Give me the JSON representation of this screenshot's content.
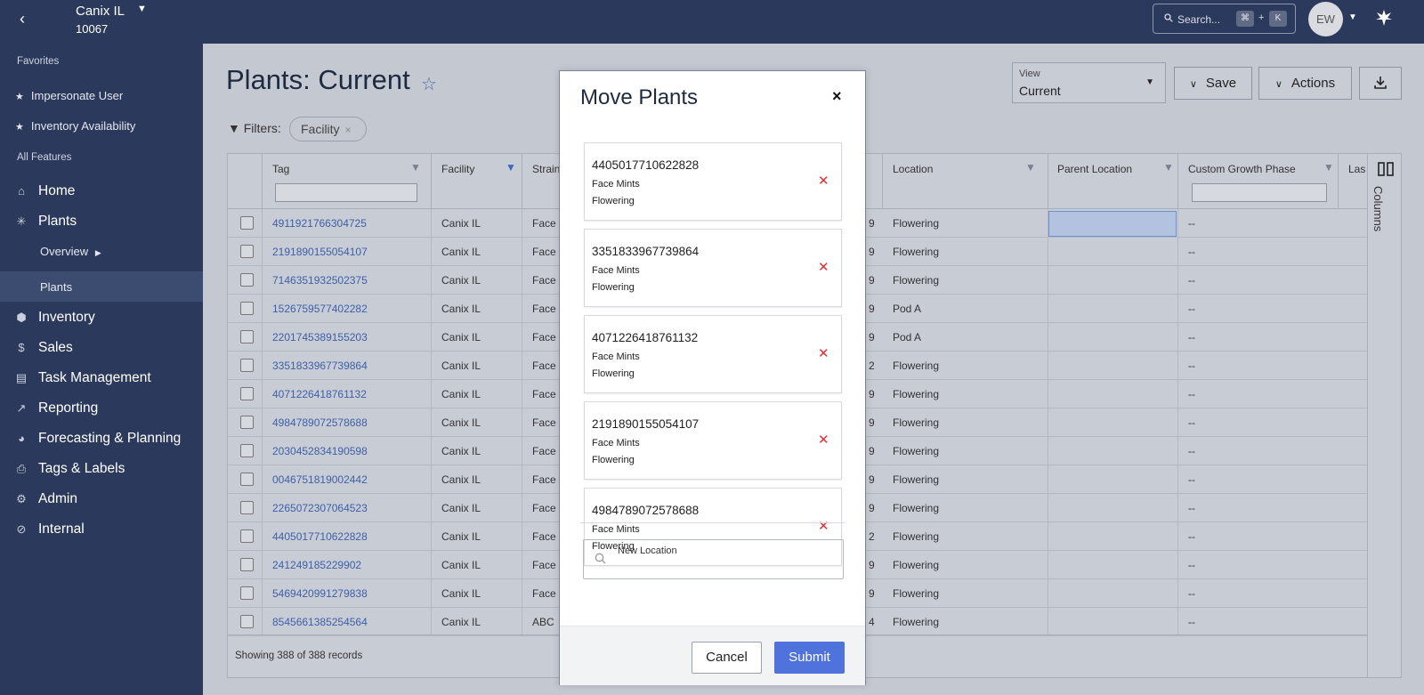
{
  "topbar": {
    "facility_name": "Canix IL",
    "facility_id": "10067",
    "search_placeholder": "Search...",
    "kbd_cmd": "⌘",
    "kbd_plus": "+",
    "kbd_k": "K",
    "avatar_initials": "EW"
  },
  "sidebar": {
    "favorites_heading": "Favorites",
    "favorites": [
      {
        "label": "Impersonate User"
      },
      {
        "label": "Inventory Availability"
      }
    ],
    "all_features_heading": "All Features",
    "items": [
      {
        "label": "Home",
        "icon": "home-icon"
      },
      {
        "label": "Plants",
        "icon": "cannabis-leaf-icon"
      },
      {
        "label": "Inventory",
        "icon": "cube-icon"
      },
      {
        "label": "Sales",
        "icon": "dollar-icon"
      },
      {
        "label": "Task Management",
        "icon": "clipboard-icon"
      },
      {
        "label": "Reporting",
        "icon": "trend-up-icon"
      },
      {
        "label": "Forecasting & Planning",
        "icon": "pie-chart-icon"
      },
      {
        "label": "Tags & Labels",
        "icon": "printer-icon"
      },
      {
        "label": "Admin",
        "icon": "gear-icon"
      },
      {
        "label": "Internal",
        "icon": "eye-slash-icon"
      }
    ],
    "plants_sub": [
      {
        "label": "Overview"
      },
      {
        "label": "Plants"
      }
    ]
  },
  "main": {
    "title": "Plants: Current",
    "filters_label": "Filters:",
    "filter_chip": "Facility",
    "view_label": "View",
    "view_value": "Current",
    "save_label": "Save",
    "actions_label": "Actions"
  },
  "table": {
    "headers": {
      "tag": "Tag",
      "facility": "Facility",
      "strain": "Strain",
      "location": "Location",
      "parent_location": "Parent Location",
      "custom_growth_phase": "Custom Growth Phase",
      "last": "Las"
    },
    "rows": [
      {
        "tag": "4911921766304725",
        "facility": "Canix IL",
        "strain": "Face M",
        "n": "9",
        "location": "Flowering",
        "cgp": "--"
      },
      {
        "tag": "2191890155054107",
        "facility": "Canix IL",
        "strain": "Face M",
        "n": "9",
        "location": "Flowering",
        "cgp": "--"
      },
      {
        "tag": "7146351932502375",
        "facility": "Canix IL",
        "strain": "Face M",
        "n": "9",
        "location": "Flowering",
        "cgp": "--"
      },
      {
        "tag": "1526759577402282",
        "facility": "Canix IL",
        "strain": "Face M",
        "n": "9",
        "location": "Pod A",
        "cgp": "--"
      },
      {
        "tag": "2201745389155203",
        "facility": "Canix IL",
        "strain": "Face M",
        "n": "9",
        "location": "Pod A",
        "cgp": "--"
      },
      {
        "tag": "3351833967739864",
        "facility": "Canix IL",
        "strain": "Face M",
        "n": "2",
        "location": "Flowering",
        "cgp": "--"
      },
      {
        "tag": "4071226418761132",
        "facility": "Canix IL",
        "strain": "Face M",
        "n": "9",
        "location": "Flowering",
        "cgp": "--"
      },
      {
        "tag": "4984789072578688",
        "facility": "Canix IL",
        "strain": "Face M",
        "n": "9",
        "location": "Flowering",
        "cgp": "--"
      },
      {
        "tag": "2030452834190598",
        "facility": "Canix IL",
        "strain": "Face M",
        "n": "9",
        "location": "Flowering",
        "cgp": "--"
      },
      {
        "tag": "0046751819002442",
        "facility": "Canix IL",
        "strain": "Face M",
        "n": "9",
        "location": "Flowering",
        "cgp": "--"
      },
      {
        "tag": "2265072307064523",
        "facility": "Canix IL",
        "strain": "Face M",
        "n": "9",
        "location": "Flowering",
        "cgp": "--"
      },
      {
        "tag": "4405017710622828",
        "facility": "Canix IL",
        "strain": "Face M",
        "n": "2",
        "location": "Flowering",
        "cgp": "--"
      },
      {
        "tag": "241249185229902",
        "facility": "Canix IL",
        "strain": "Face M",
        "n": "9",
        "location": "Flowering",
        "cgp": "--"
      },
      {
        "tag": "5469420991279838",
        "facility": "Canix IL",
        "strain": "Face M",
        "n": "9",
        "location": "Flowering",
        "cgp": "--"
      },
      {
        "tag": "8545661385254564",
        "facility": "Canix IL",
        "strain": "ABC",
        "n": "4",
        "location": "Flowering",
        "cgp": "--"
      }
    ],
    "footer": "Showing 388 of 388 records",
    "columns_label": "Columns"
  },
  "modal": {
    "title": "Move Plants",
    "close": "×",
    "plants": [
      {
        "tag": "4405017710622828",
        "strain": "Face Mints",
        "location": "Flowering"
      },
      {
        "tag": "3351833967739864",
        "strain": "Face Mints",
        "location": "Flowering"
      },
      {
        "tag": "4071226418761132",
        "strain": "Face Mints",
        "location": "Flowering"
      },
      {
        "tag": "2191890155054107",
        "strain": "Face Mints",
        "location": "Flowering"
      },
      {
        "tag": "4984789072578688",
        "strain": "Face Mints",
        "location": "Flowering"
      }
    ],
    "new_location_label": "New Location",
    "cancel_label": "Cancel",
    "submit_label": "Submit"
  },
  "colors": {
    "nav_bg": "#2b3a5c",
    "link": "#3e5fa8",
    "primary_button": "#5072dc",
    "remove_x": "#e03030"
  }
}
